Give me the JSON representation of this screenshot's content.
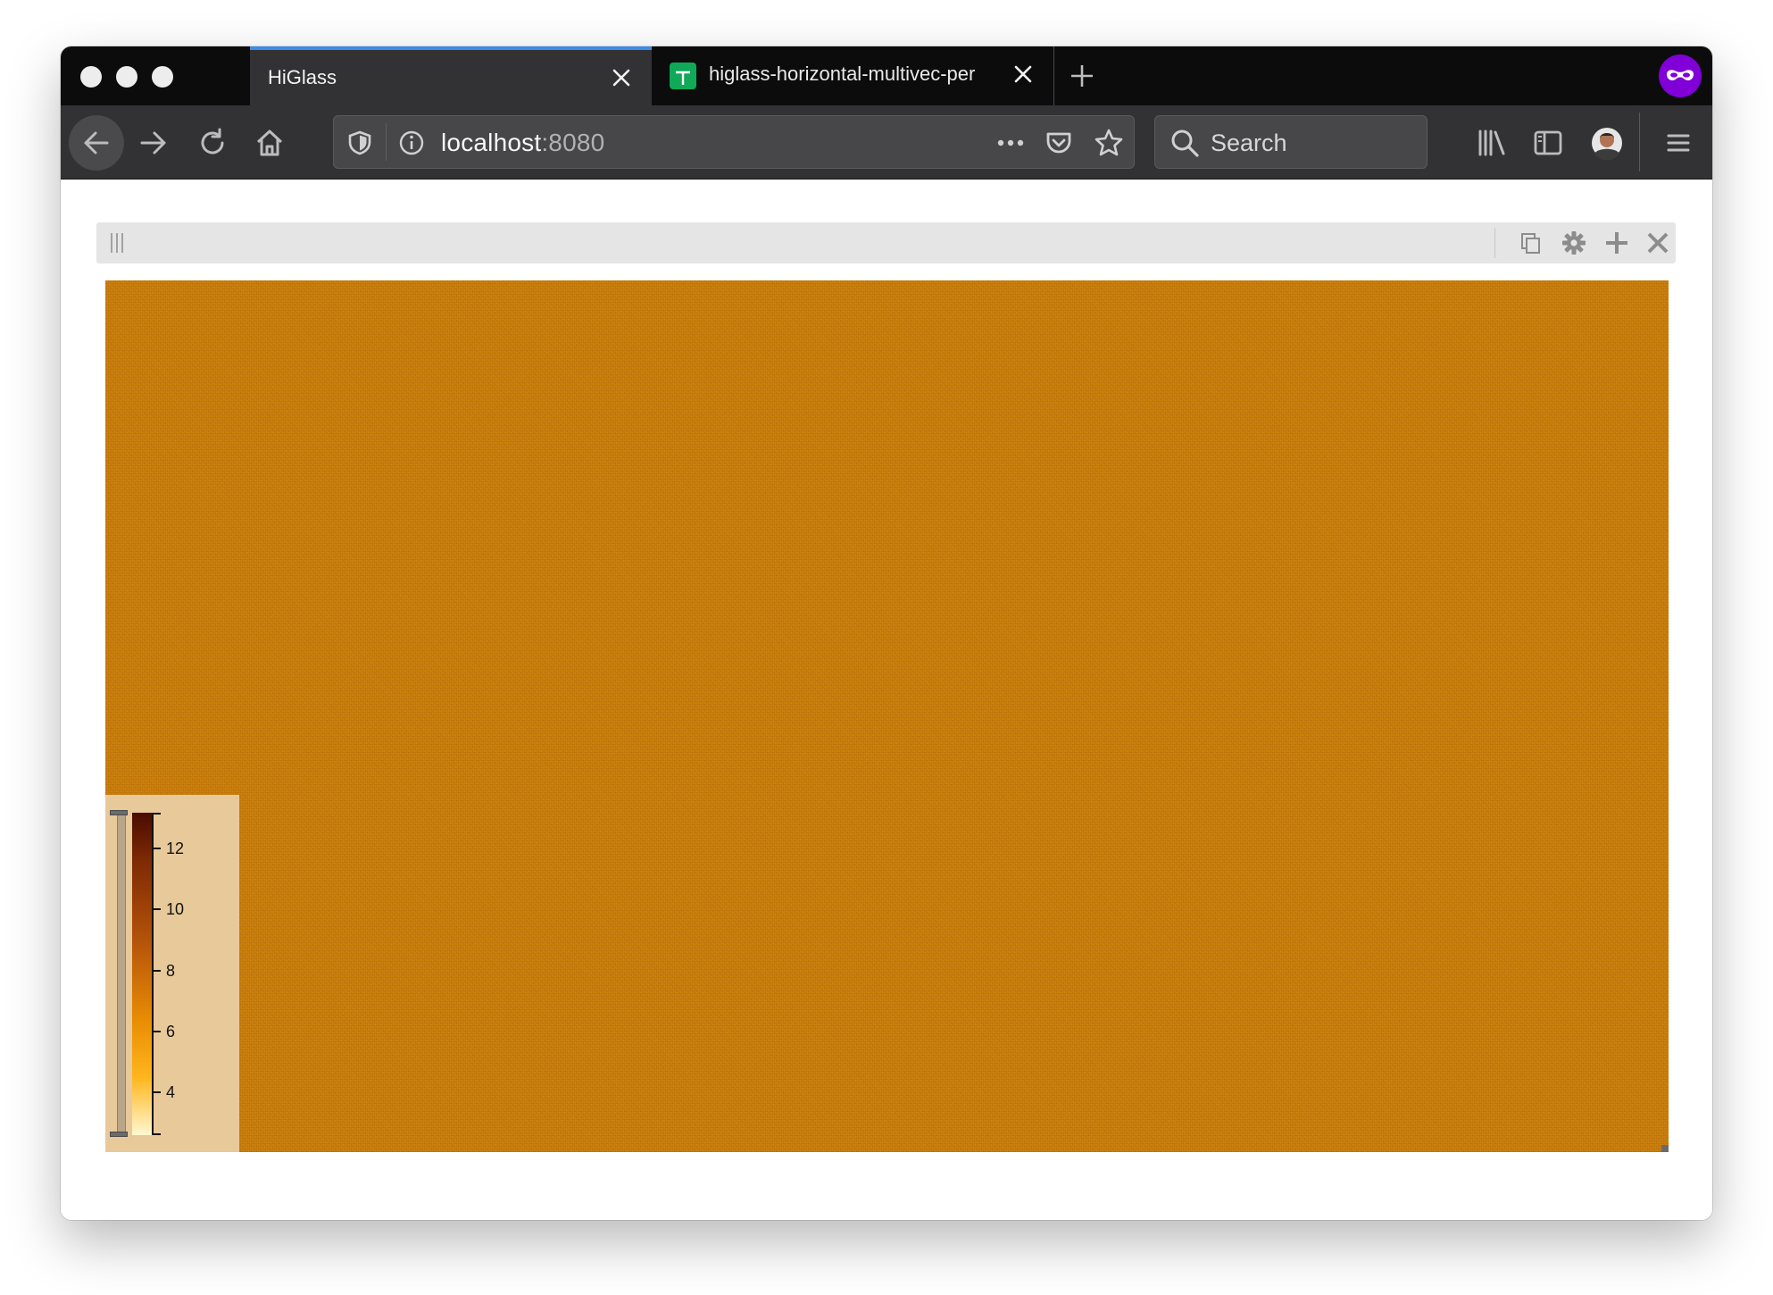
{
  "browser": {
    "tabs": [
      {
        "title": "HiGlass",
        "active": true
      },
      {
        "title": "higlass-horizontal-multivec-per",
        "active": false
      }
    ],
    "url": {
      "host": "localhost",
      "port": ":8080"
    },
    "search_placeholder": "Search"
  },
  "view": {
    "header_icons": [
      "drag-handle-icon",
      "copy-icon",
      "gear-icon",
      "plus-icon",
      "close-icon"
    ]
  },
  "colorbar": {
    "ticks": [
      "12",
      "10",
      "8",
      "6",
      "4"
    ],
    "colors": [
      "#4a0c02",
      "#7e2a05",
      "#b5530a",
      "#e98e05",
      "#ffb51c",
      "#fff7d0"
    ]
  },
  "colors": {
    "accent_tab": "#3b8be8",
    "heatmap_base": "#c77b0a",
    "private_badge": "#8000d7"
  }
}
